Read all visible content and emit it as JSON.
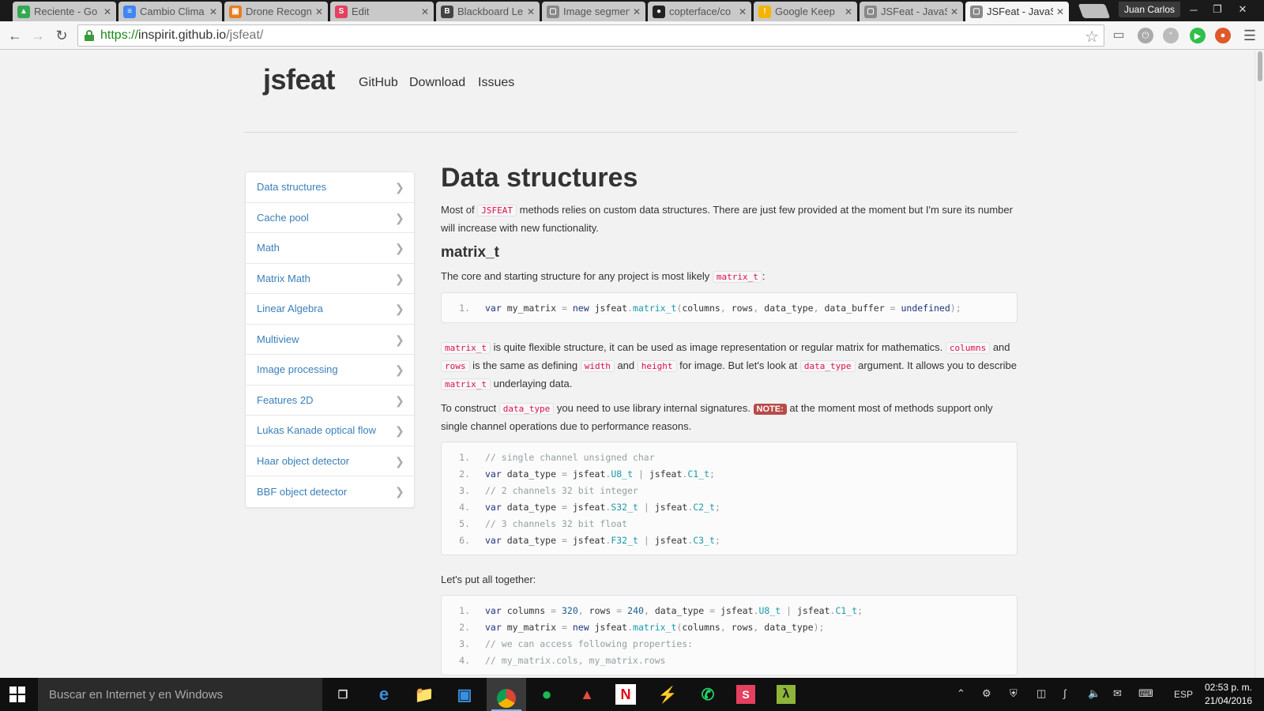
{
  "browser": {
    "tabs": [
      {
        "label": "Reciente - Go",
        "color": "#34a853",
        "glyph": "▲"
      },
      {
        "label": "Cambio Clima",
        "color": "#4285f4",
        "glyph": "≡"
      },
      {
        "label": "Drone Recogn",
        "color": "#e67e22",
        "glyph": "▣"
      },
      {
        "label": "Edit",
        "color": "#e4405f",
        "glyph": "S"
      },
      {
        "label": "Blackboard Le",
        "color": "#444444",
        "glyph": "B"
      },
      {
        "label": "Image segmen",
        "color": "#888888",
        "glyph": "▢"
      },
      {
        "label": "copterface/co",
        "color": "#222222",
        "glyph": "●"
      },
      {
        "label": "Google Keep",
        "color": "#f4b400",
        "glyph": "!"
      },
      {
        "label": "JSFeat - JavaS",
        "color": "#888888",
        "glyph": "▢"
      },
      {
        "label": "JSFeat - JavaS",
        "color": "#888888",
        "glyph": "▢"
      }
    ],
    "profile_name": "Juan Carlos",
    "window_controls": [
      "─",
      "❐",
      "✕"
    ],
    "url": {
      "scheme": "https://",
      "host": "inspirit.github.io",
      "path": "/jsfeat/"
    }
  },
  "site": {
    "brand": "jsfeat",
    "nav": [
      "GitHub",
      "Download",
      "Issues"
    ]
  },
  "sidebar": {
    "items": [
      "Data structures",
      "Cache pool",
      "Math",
      "Matrix Math",
      "Linear Algebra",
      "Multiview",
      "Image processing",
      "Features 2D",
      "Lukas Kanade optical flow",
      "Haar object detector",
      "BBF object detector"
    ]
  },
  "content": {
    "title": "Data structures",
    "intro": {
      "before": "Most of ",
      "code": "JSFEAT",
      "after": " methods relies on custom data structures. There are just few provided at the moment but I'm sure its number will increase with new functionality."
    },
    "section_title": "matrix_t",
    "core": {
      "before": "The core and starting structure for any project is most likely ",
      "code": "matrix_t",
      "after": ":"
    },
    "flex_para": {
      "s1": "matrix_t",
      "t1": " is quite flexible structure, it can be used as image representation or regular matrix for mathematics. ",
      "s2": "columns",
      "t2": " and ",
      "s3": "rows",
      "t3": " is the same as defining ",
      "s4": "width",
      "t4": " and ",
      "s5": "height",
      "t5": " for image. But let's look at ",
      "s6": "data_type",
      "t6": " argument. It allows you to describe ",
      "s7": "matrix_t",
      "t7": " underlaying data."
    },
    "construct_para": {
      "before": "To construct ",
      "code": "data_type",
      "mid": " you need to use library internal signatures. ",
      "note": "NOTE:",
      "after": " at the moment most of methods support only single channel operations due to performance reasons."
    },
    "together": "Let's put all together:"
  },
  "taskbar": {
    "search_placeholder": "Buscar en Internet y en Windows",
    "language": "ESP",
    "time": "02:53 p. m.",
    "date": "21/04/2016"
  }
}
